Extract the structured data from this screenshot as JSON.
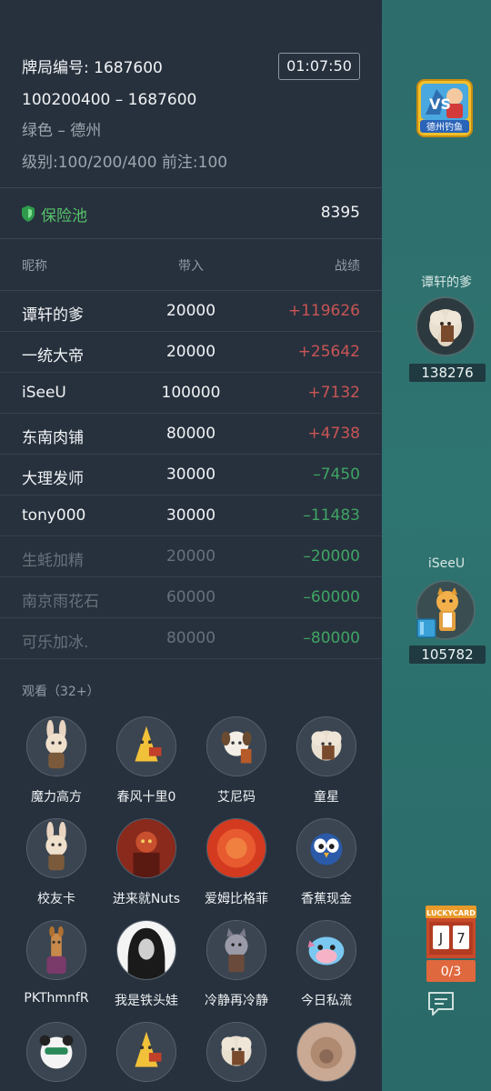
{
  "game_info": {
    "table_no": "牌局编号: 1687600",
    "timer": "01:07:50",
    "blinds_line": "100200400 –  1687600",
    "room": "绿色 – 德州",
    "level": "级别:100/200/400 前注:100"
  },
  "insurance": {
    "label": "保险池",
    "value": "8395",
    "icon": "shield-icon"
  },
  "table": {
    "headers": [
      "昵称",
      "带入",
      "战绩"
    ],
    "rows": [
      {
        "name": "谭轩的爹",
        "buyin": "20000",
        "result": "+119626",
        "type": "pos",
        "active": true
      },
      {
        "name": "一统大帝",
        "buyin": "20000",
        "result": "+25642",
        "type": "pos",
        "active": true
      },
      {
        "name": "iSeeU",
        "buyin": "100000",
        "result": "+7132",
        "type": "pos",
        "active": true
      },
      {
        "name": "东南肉铺",
        "buyin": "80000",
        "result": "+4738",
        "type": "pos",
        "active": true
      },
      {
        "name": "大理发师",
        "buyin": "30000",
        "result": "–7450",
        "type": "neg",
        "active": true
      },
      {
        "name": "tony000",
        "buyin": "30000",
        "result": "–11483",
        "type": "neg",
        "active": true
      },
      {
        "name": "生蚝加精",
        "buyin": "20000",
        "result": "–20000",
        "type": "neg",
        "active": false
      },
      {
        "name": "南京雨花石",
        "buyin": "60000",
        "result": "–60000",
        "type": "neg",
        "active": false
      },
      {
        "name": "可乐加冰.",
        "buyin": "80000",
        "result": "–80000",
        "type": "neg",
        "active": false
      }
    ]
  },
  "spectators": {
    "title": "观看（32+）",
    "items": [
      {
        "name": "魔力高方",
        "avatar": "rabbit"
      },
      {
        "name": "春风十里0",
        "avatar": "cone"
      },
      {
        "name": "艾尼码",
        "avatar": "dog"
      },
      {
        "name": "童星",
        "avatar": "sheep"
      },
      {
        "name": "校友卡",
        "avatar": "rabbit"
      },
      {
        "name": "进来就Nuts",
        "avatar": "hero"
      },
      {
        "name": "爱姆比格菲",
        "avatar": "red"
      },
      {
        "name": "香蕉现金",
        "avatar": "bird"
      },
      {
        "name": "PKThmnfR",
        "avatar": "llama"
      },
      {
        "name": "我是铁头娃",
        "avatar": "hood"
      },
      {
        "name": "冷静再冷静",
        "avatar": "wolf"
      },
      {
        "name": "今日私流",
        "avatar": "fish"
      },
      {
        "name": "",
        "avatar": "panda"
      },
      {
        "name": "",
        "avatar": "cone"
      },
      {
        "name": "",
        "avatar": "sheep"
      },
      {
        "name": "",
        "avatar": "photo"
      }
    ]
  },
  "right_panel": {
    "vs_badge_text": "德州钓鱼",
    "seats": [
      {
        "name": "谭轩的爹",
        "chips": "138276",
        "avatar": "sheep"
      },
      {
        "name": "iSeeU",
        "chips": "105782",
        "avatar": "tiger"
      }
    ],
    "lucky_card": {
      "title": "LUCKYCARD",
      "cards": [
        "J",
        "7"
      ],
      "count": "0/3"
    },
    "chat_icon": "chat-icon"
  },
  "colors": {
    "panel_bg": "#27313d",
    "positive": "#c85555",
    "negative": "#3fa463",
    "insurance_green": "#56c26a",
    "game_teal": "#2e7470"
  }
}
